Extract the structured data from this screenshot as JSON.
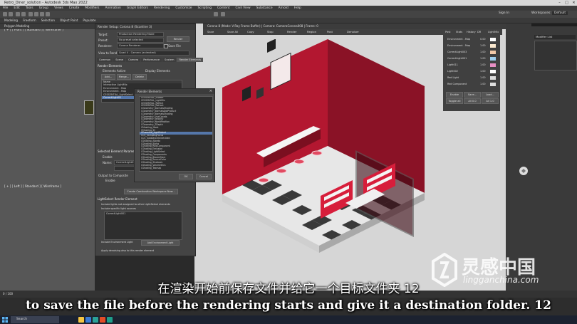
{
  "app": {
    "title": "Retro_Diner_solution - Autodesk 3ds Max 2022",
    "window_buttons": [
      "–",
      "□",
      "✕"
    ]
  },
  "menubar": [
    "File",
    "Edit",
    "Tools",
    "Group",
    "Views",
    "Create",
    "Modifiers",
    "Animation",
    "Graph Editors",
    "Rendering",
    "Customize",
    "Scripting",
    "Content",
    "Civil View",
    "Substance",
    "Arnold",
    "Help"
  ],
  "toolbar_sign_in": "Sign In",
  "toolbar_workspaces": "Workspaces:",
  "toolbar_workspace_value": "Default",
  "ribbon": [
    "Modeling",
    "Freeform",
    "Selection",
    "Object Paint",
    "Populate"
  ],
  "ribbon_sub": "Polygon Modeling",
  "left_viewport": {
    "label_top": "[ + ] [ Front ] [ Standard ] [ Wireframe ]",
    "label_bottom": "[ + ] [ Left ] [ Standard ] [ Wireframe ]"
  },
  "render_setup": {
    "title": "Render Setup: Corona 8 (Scanline 3)",
    "target_label": "Target:",
    "target_value": "Production Rendering Mode",
    "preset_label": "Preset:",
    "preset_value": "No preset selected",
    "renderer_label": "Renderer:",
    "renderer_value": "Corona Renderer",
    "save_file_label": "Save File",
    "view_label": "View to Render:",
    "view_value": "Quad 4 - Camera (animated)",
    "render_button": "Render",
    "tabs": [
      "Common",
      "Scene",
      "Camera",
      "Performance",
      "System",
      "Render Elements"
    ],
    "section_render_elements": "Render Elements",
    "elements_active": "Elements Active",
    "display_elements": "Display Elements",
    "add_btn": "Add...",
    "merge_btn": "Merge...",
    "delete_btn": "Delete",
    "list_headers": [
      "Name",
      "Enabled",
      "Filter",
      "Type",
      "Output Path"
    ],
    "list_items": [
      "Interactive LightMix",
      "Environment - Map",
      "Environment - Map",
      "CESSENTIAL_LightSelect",
      "CorrectLight01",
      "LinearLight",
      "Clinical09"
    ],
    "selected_element_params": "Selected Element Parameters",
    "enable_label": "Enable",
    "name_label": "Name:",
    "name_value": "CorrectLight01",
    "output_label": "Output to Composite",
    "enable2_label": "Enable",
    "create_btn": "Create Combustion Workspace Now...",
    "light_select_section": "LightSelect Render Element",
    "light_opt1": "Include lights not assigned to other LightSelect elements",
    "light_opt2": "Include specific light sources",
    "light_list_value": "CorrectLight001",
    "include_env": "Include Environment Light",
    "env_btn": "Add Environment Light",
    "apply_denoise": "Apply denoising also to this render element"
  },
  "render_elements_popup": {
    "title": "Render Elements",
    "items": [
      "CESSENTIAL_Shader",
      "CESSENTIAL_LightMix",
      "CESSENTIAL_Reflect",
      "CESSENTIAL_Refract",
      "CGeometry_NormalsShading",
      "CGeometry_NormalsDotProduct",
      "CGeometry_NormalsShading",
      "CGeometry_UvwCoords",
      "CGeometry_Velocity",
      "CGeometry_WorldPosition",
      "CGeometry_ZDepth",
      "CMasking_Mask",
      "CMasking_ID",
      "CEssential_LightSelect",
      "CCS_SamplingFocus",
      "CCS_SubstanceUndecided",
      "CShading_Albedo",
      "CShading_Alpha",
      "CShading_RawComponent",
      "CShading_Emission",
      "CShading_LightSelect",
      "CShading_Components",
      "CShading_BloomGlare",
      "CShading_SourceColor",
      "CShading_Shadows",
      "CShading_Volumetrics",
      "CShading_Texmap"
    ],
    "ok_btn": "OK",
    "cancel_btn": "Cancel"
  },
  "vfb": {
    "title": "Corona 8 (Mode: V-Ray Frame Buffer) | Camera: CameraCorona008 | Frame: 0",
    "tools": [
      "Save",
      "Save All",
      "Copy",
      "Stop",
      "Render",
      "Region",
      "Post",
      "Denoiser"
    ]
  },
  "lightmix_panel": {
    "tabs": [
      "Post",
      "Stats",
      "History",
      "DR",
      "LightMix"
    ],
    "rows": [
      {
        "name": "Environment - Map",
        "value": "0.00",
        "swatch": "#ffffff"
      },
      {
        "name": "Environment - Map",
        "value": "1.00",
        "swatch": "#fbe9d0"
      },
      {
        "name": "CorrectLight003",
        "value": "1.00",
        "swatch": "#f2c9a8"
      },
      {
        "name": "CorrectLight001",
        "value": "1.00",
        "swatch": "#9fd0f0"
      },
      {
        "name": "Light011",
        "value": "1.00",
        "swatch": "#e88fc4"
      },
      {
        "name": "Light002",
        "value": "1.00",
        "swatch": "#ffffff"
      },
      {
        "name": "Red Light",
        "value": "1.00",
        "swatch": "#dddddd"
      },
      {
        "name": "Red Component",
        "value": "1.00",
        "swatch": "#dddddd"
      }
    ],
    "buttons": [
      "Enable",
      "Save...",
      "Load...",
      "Toggle all",
      "All 0.0",
      "All 1.0"
    ]
  },
  "command_panel": {
    "header": "Modifier List",
    "workspaces": "Workspaces"
  },
  "timeline": {
    "frame": "0 / 100"
  },
  "taskbar": {
    "search_placeholder": "Search"
  },
  "subtitles": {
    "chinese": "在渲染开始前保存文件并给它一个目标文件夹 12",
    "english": "to save the file before the rendering starts and give it a destination folder. 12"
  },
  "watermark": {
    "main": "灵感中国",
    "sub": "lingganchina.com"
  },
  "colors": {
    "diner_red": "#c41e3a",
    "ui_dark": "#3c3c3c",
    "list_select": "#5577aa"
  }
}
